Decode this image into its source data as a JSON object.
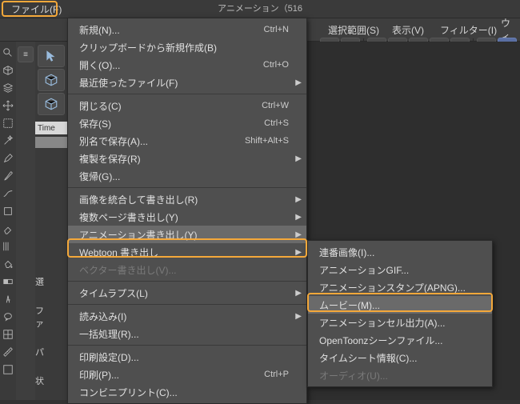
{
  "title": "アニメーション（516",
  "menubar": {
    "file": "ファイル(F)",
    "select": "選択範囲(S)",
    "view": "表示(V)",
    "filter": "フィルター(I)",
    "win": "ウィ"
  },
  "file_menu": [
    {
      "label": "新規(N)...",
      "shortcut": "Ctrl+N"
    },
    {
      "label": "クリップボードから新規作成(B)"
    },
    {
      "label": "開く(O)...",
      "shortcut": "Ctrl+O"
    },
    {
      "label": "最近使ったファイル(F)",
      "submenu": true
    },
    {
      "sep": true
    },
    {
      "label": "閉じる(C)",
      "shortcut": "Ctrl+W"
    },
    {
      "label": "保存(S)",
      "shortcut": "Ctrl+S"
    },
    {
      "label": "別名で保存(A)...",
      "shortcut": "Shift+Alt+S"
    },
    {
      "label": "複製を保存(R)",
      "submenu": true
    },
    {
      "label": "復帰(G)..."
    },
    {
      "sep": true
    },
    {
      "label": "画像を統合して書き出し(R)",
      "submenu": true
    },
    {
      "label": "複数ページ書き出し(Y)",
      "submenu": true
    },
    {
      "label": "アニメーション書き出し(Y)",
      "submenu": true,
      "hl": true
    },
    {
      "label": "Webtoon 書き出し",
      "submenu": true
    },
    {
      "label": "ベクター書き出し(V)...",
      "disabled": true
    },
    {
      "sep": true
    },
    {
      "label": "タイムラプス(L)",
      "submenu": true
    },
    {
      "sep": true
    },
    {
      "label": "読み込み(I)",
      "submenu": true
    },
    {
      "label": "一括処理(R)..."
    },
    {
      "sep": true
    },
    {
      "label": "印刷設定(D)..."
    },
    {
      "label": "印刷(P)...",
      "shortcut": "Ctrl+P"
    },
    {
      "label": "コンビニプリント(C)..."
    }
  ],
  "anim_submenu": [
    {
      "label": "連番画像(I)..."
    },
    {
      "label": "アニメーションGIF..."
    },
    {
      "label": "アニメーションスタンプ(APNG)..."
    },
    {
      "label": "ムービー(M)...",
      "hl": true
    },
    {
      "label": "アニメーションセル出力(A)..."
    },
    {
      "label": "OpenToonzシーンファイル..."
    },
    {
      "label": "タイムシート情報(C)..."
    },
    {
      "label": "オーディオ(U)...",
      "disabled": true
    }
  ],
  "side": {
    "time": "Time",
    "sel": "選",
    "fa": "ファ",
    "pa": "パ",
    "jo": "状"
  }
}
